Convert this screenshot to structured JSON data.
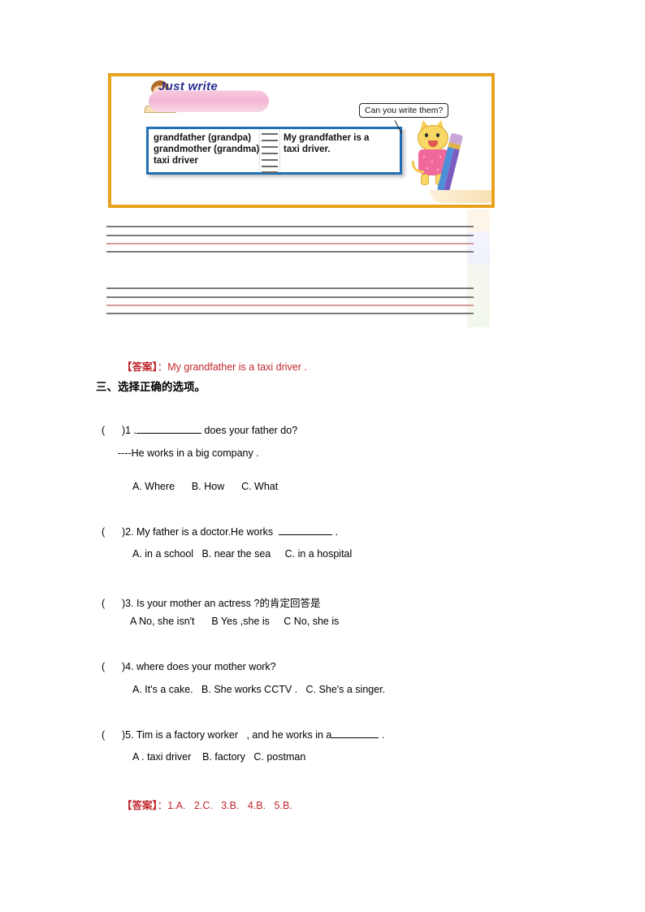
{
  "figure": {
    "badge_label": "Just write",
    "notebook_left_words": "grandfather (grandpa)\ngrandmother (grandma)\ntaxi driver",
    "notebook_right_words": "My grandfather is a\ntaxi driver.",
    "speech_bubble": "Can you write them?",
    "border_color": "#E9A21C",
    "notebook_border_color": "#1F6FB2",
    "badge_text_color": "#2a2f91"
  },
  "writing_answer": {
    "label": "【答案】",
    "separator": "：",
    "text": "My grandfather is a taxi driver ."
  },
  "section": {
    "heading": "三、选择正确的选项。"
  },
  "questions": [
    {
      "marker": "(      )",
      "number": "1",
      "stem_before": " .",
      "stem_after": " does your father do?",
      "blank": "w1",
      "subline": "----He works in a big company .",
      "options": "A. Where      B. How      C. What"
    },
    {
      "marker": "(      )",
      "number": "2",
      "stem_before": ". My father is a doctor.He works  ",
      "stem_after": " .",
      "blank": "w2",
      "subline": "",
      "options": "A. in a school   B. near the sea     C. in a hospital"
    },
    {
      "marker": "(      )",
      "number": "3",
      "stem_before": ". Is your mother an actress ?的肯定回答是",
      "stem_after": "",
      "blank": "",
      "subline": "",
      "options": "A No, she isn't      B Yes ,she is     C No, she is"
    },
    {
      "marker": "(      )",
      "number": "4",
      "stem_before": ". where does your mother work?",
      "stem_after": "",
      "blank": "",
      "subline": "",
      "options": "A. It's a cake.   B. She works CCTV .   C. She's a singer."
    },
    {
      "marker": "(      )",
      "number": "5",
      "stem_before": ". Tim is a factory worker   , and he works in a",
      "stem_after": " .",
      "blank": "w3",
      "subline": "",
      "options": "A . taxi driver    B. factory   C. postman"
    }
  ],
  "choice_answer": {
    "label": "【答案】",
    "separator": "：",
    "text": "1.A.   2.C.   3.B.   4.B.   5.B."
  },
  "colors": {
    "answer_red": "#C1272D",
    "rule_gray": "#7a7a7a",
    "rule_red": "#d79a9a"
  }
}
